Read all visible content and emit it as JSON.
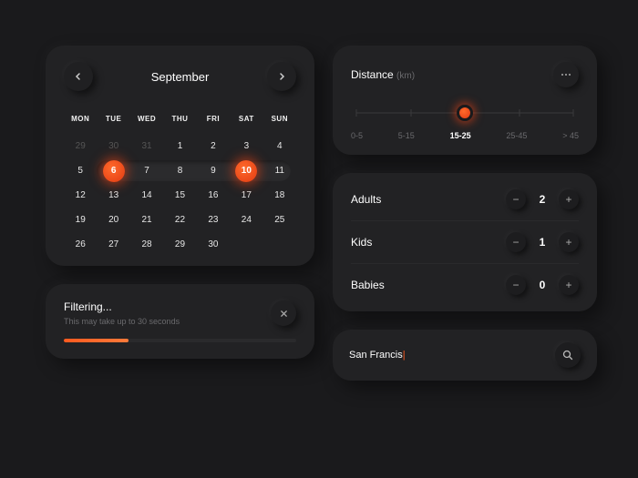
{
  "colors": {
    "accent": "#ff5a1f"
  },
  "calendar": {
    "month_label": "September",
    "dow": [
      "MON",
      "TUE",
      "WED",
      "THU",
      "FRI",
      "SAT",
      "SUN"
    ],
    "weeks": [
      [
        {
          "n": 29,
          "muted": true
        },
        {
          "n": 30,
          "muted": true
        },
        {
          "n": 31,
          "muted": true
        },
        {
          "n": 1
        },
        {
          "n": 2
        },
        {
          "n": 3
        },
        {
          "n": 4
        }
      ],
      [
        {
          "n": 5
        },
        {
          "n": 6,
          "start": true
        },
        {
          "n": 7
        },
        {
          "n": 8
        },
        {
          "n": 9
        },
        {
          "n": 10,
          "end": true
        },
        {
          "n": 11
        }
      ],
      [
        {
          "n": 12
        },
        {
          "n": 13
        },
        {
          "n": 14
        },
        {
          "n": 15
        },
        {
          "n": 16
        },
        {
          "n": 17
        },
        {
          "n": 18
        }
      ],
      [
        {
          "n": 19
        },
        {
          "n": 20
        },
        {
          "n": 21
        },
        {
          "n": 22
        },
        {
          "n": 23
        },
        {
          "n": 24
        },
        {
          "n": 25
        }
      ],
      [
        {
          "n": 26
        },
        {
          "n": 27
        },
        {
          "n": 28
        },
        {
          "n": 29
        },
        {
          "n": 30
        },
        {
          "n": "",
          "muted": true
        },
        {
          "n": "",
          "muted": true
        }
      ]
    ],
    "range": {
      "start": 6,
      "end": 10
    }
  },
  "filtering": {
    "title": "Filtering...",
    "subtitle": "This may take up to 30 seconds",
    "progress_pct": 28
  },
  "distance": {
    "title": "Distance",
    "unit_label": "(km)",
    "options": [
      "0-5",
      "5-15",
      "15-25",
      "25-45",
      "> 45"
    ],
    "selected_index": 2
  },
  "guests": {
    "rows": [
      {
        "label": "Adults",
        "value": 2
      },
      {
        "label": "Kids",
        "value": 1
      },
      {
        "label": "Babies",
        "value": 0
      }
    ]
  },
  "search": {
    "value": "San Francis",
    "placeholder": "Search"
  }
}
